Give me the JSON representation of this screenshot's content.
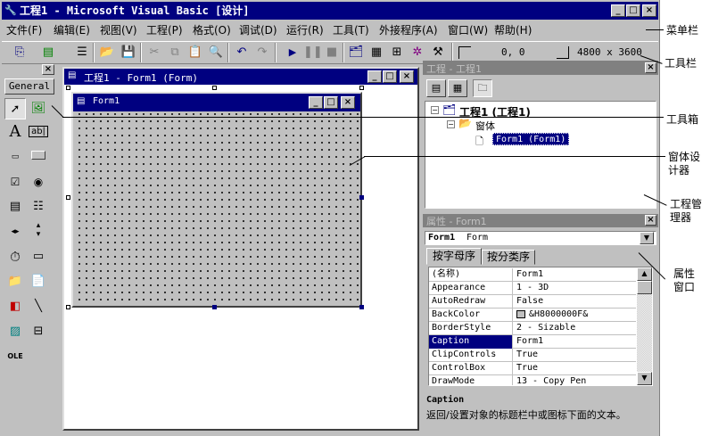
{
  "window": {
    "title": "工程1 - Microsoft Visual Basic [设计]"
  },
  "menu": [
    "文件(F)",
    "编辑(E)",
    "视图(V)",
    "工程(P)",
    "格式(O)",
    "调试(D)",
    "运行(R)",
    "工具(T)",
    "外接程序(A)",
    "窗口(W)",
    "帮助(H)"
  ],
  "toolbar": {
    "position": "0, 0",
    "size": "4800 x 3600"
  },
  "toolbox": {
    "tab_label": "General"
  },
  "form_designer": {
    "title": "工程1 - Form1 (Form)",
    "form_title": "Form1"
  },
  "project": {
    "title": "工程 - 工程1",
    "root": "工程1 (工程1)",
    "folder": "窗体",
    "item": "Form1 (Form1)"
  },
  "properties": {
    "title": "属性 - Form1",
    "object_name": "Form1",
    "object_type": "Form",
    "tabs": [
      "按字母序",
      "按分类序"
    ],
    "rows": [
      {
        "name": "(名称)",
        "value": "Form1"
      },
      {
        "name": "Appearance",
        "value": "1 - 3D"
      },
      {
        "name": "AutoRedraw",
        "value": "False"
      },
      {
        "name": "BackColor",
        "value": "&H8000000F&"
      },
      {
        "name": "BorderStyle",
        "value": "2 - Sizable"
      },
      {
        "name": "Caption",
        "value": "Form1"
      },
      {
        "name": "ClipControls",
        "value": "True"
      },
      {
        "name": "ControlBox",
        "value": "True"
      },
      {
        "name": "DrawMode",
        "value": "13 - Copy Pen"
      }
    ],
    "selected_row": 5,
    "desc_title": "Caption",
    "desc_text": "返回/设置对象的标题栏中或图标下面的文本。"
  },
  "annotations": {
    "menubar": "菜单栏",
    "toolbar": "工具栏",
    "toolbox": "工具箱",
    "form_designer_1": "窗体设",
    "form_designer_2": "计器",
    "project_1": "工程管",
    "project_2": "理器",
    "props_1": "属性",
    "props_2": "窗口"
  },
  "colors": {
    "title_active": "#000080",
    "face": "#c0c0c0",
    "selection": "#000080"
  },
  "icons": [
    "vb-app-icon",
    "minimize-icon",
    "maximize-icon",
    "close-icon",
    "pointer-icon",
    "picturebox-icon",
    "label-icon",
    "textbox-icon",
    "frame-icon",
    "commandbutton-icon",
    "checkbox-icon",
    "optionbutton-icon",
    "combobox-icon",
    "listbox-icon",
    "hscrollbar-icon",
    "vscrollbar-icon",
    "timer-icon",
    "drivelistbox-icon",
    "dirlistbox-icon",
    "filelistbox-icon",
    "shape-icon",
    "line-icon",
    "image-icon",
    "data-icon",
    "ole-icon",
    "folder-icon",
    "form-icon",
    "project-icon"
  ]
}
